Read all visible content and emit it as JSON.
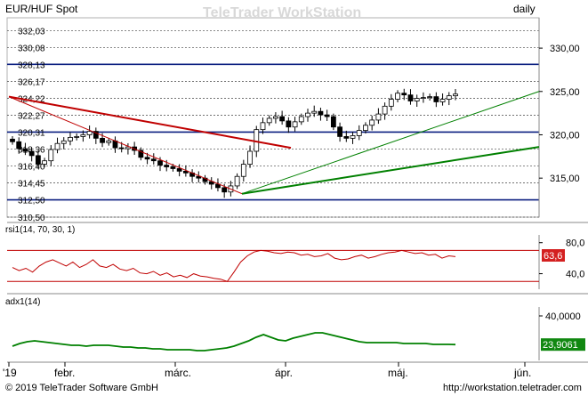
{
  "header": {
    "symbol": "EUR/HUF Spot",
    "watermark": "TeleTrader WorkStation",
    "interval": "daily"
  },
  "footer": {
    "copyright": "© 2019 TeleTrader Software GmbH",
    "url": "http://workstation.teletrader.com"
  },
  "chart_data": [
    {
      "type": "candlestick",
      "panel": "price",
      "x_labels": [
        "'19",
        "febr.",
        "márc.",
        "ápr.",
        "máj.",
        "jún."
      ],
      "y_ticks": [
        315.0,
        320.0,
        325.0,
        330.0
      ],
      "y_range": [
        310.5,
        333.5
      ],
      "fib_levels": [
        332.03,
        330.08,
        328.13,
        326.17,
        324.22,
        322.27,
        320.31,
        318.36,
        316.4,
        314.45,
        312.5,
        310.5
      ],
      "fib_labels": [
        "332,03",
        "330,08",
        "328,13",
        "326,17",
        "324,22",
        "322,27",
        "320,31",
        "318,36",
        "316,40",
        "314,45",
        "312,50",
        "310,50"
      ],
      "grid": "horizontal",
      "closes": [
        319.2,
        318.4,
        318.1,
        317.6,
        316.6,
        317.0,
        318.3,
        319.0,
        319.3,
        319.7,
        319.8,
        320.0,
        320.4,
        319.6,
        319.1,
        319.3,
        318.5,
        318.4,
        318.6,
        318.2,
        317.4,
        317.2,
        317.0,
        316.5,
        316.3,
        316.1,
        315.8,
        315.6,
        315.2,
        315.0,
        314.6,
        314.3,
        313.9,
        313.4,
        314.1,
        315.2,
        316.6,
        318.1,
        320.6,
        321.4,
        321.9,
        322.1,
        321.6,
        320.9,
        321.5,
        322.1,
        322.5,
        322.7,
        322.3,
        322.1,
        320.9,
        319.8,
        319.6,
        319.9,
        320.5,
        321.1,
        321.7,
        322.4,
        323.3,
        324.1,
        324.8,
        324.6,
        323.9,
        324.2,
        324.3,
        324.4,
        323.8,
        324.1,
        324.5,
        324.7
      ],
      "trendlines": [
        {
          "color": "#c00000",
          "from": [
            "'19",
            324.4
          ],
          "to": [
            "márc.",
            318.5
          ]
        },
        {
          "color": "#c00000",
          "from": [
            "'19",
            324.4
          ],
          "to": [
            "ápr.",
            313.2
          ]
        },
        {
          "color": "#008000",
          "from": [
            "ápr.",
            313.2
          ],
          "to": [
            "jún.",
            318.6
          ]
        },
        {
          "color": "#008000",
          "from": [
            "ápr.",
            313.2
          ],
          "to": [
            "jún.",
            325.0
          ]
        }
      ]
    },
    {
      "type": "line",
      "panel": "rsi",
      "title": "rsi1(14, 70, 30, 1)",
      "y_ticks": [
        40.0,
        80.0
      ],
      "y_tick_labels": [
        "40,0",
        "80,0"
      ],
      "y_range": [
        20,
        90
      ],
      "levels": [
        70,
        30
      ],
      "last_value": 63.6,
      "last_value_label": "63,6",
      "series_color": "#c00000",
      "values": [
        48,
        44,
        47,
        42,
        50,
        55,
        58,
        54,
        50,
        55,
        48,
        52,
        58,
        50,
        48,
        52,
        46,
        44,
        47,
        41,
        40,
        43,
        38,
        41,
        36,
        38,
        35,
        40,
        37,
        36,
        34,
        33,
        30,
        42,
        55,
        63,
        68,
        70,
        69,
        67,
        66,
        68,
        67,
        64,
        65,
        62,
        63,
        66,
        60,
        58,
        59,
        62,
        64,
        60,
        62,
        65,
        67,
        68,
        70,
        68,
        66,
        67,
        64,
        65,
        60,
        63,
        62
      ]
    },
    {
      "type": "line",
      "panel": "adx",
      "title": "adx1(14)",
      "y_ticks": [
        40.0
      ],
      "y_tick_labels": [
        "40,0000"
      ],
      "y_range": [
        15,
        45
      ],
      "last_value": 23.9061,
      "last_value_label": "23,9061",
      "series_color": "#008000",
      "values": [
        23,
        24.5,
        25.5,
        26,
        25.5,
        25,
        24.5,
        24,
        23.5,
        23.5,
        23,
        23.5,
        23.5,
        23.5,
        23,
        22.5,
        22.5,
        22,
        22,
        21.5,
        21.5,
        21,
        21,
        21,
        21,
        20.5,
        20.5,
        21,
        21.5,
        22,
        23,
        24.5,
        26,
        28,
        29.5,
        28,
        26.5,
        26,
        27.5,
        28.5,
        29.5,
        30.5,
        30.5,
        29.5,
        28.5,
        27.5,
        26.5,
        25.5,
        25,
        25,
        25,
        25,
        25,
        24.5,
        24.5,
        24.5,
        24.5,
        24,
        24,
        24,
        23.9061
      ]
    }
  ],
  "colors": {
    "candle_up": "#ffffff",
    "candle_down": "#000000",
    "watermark": "#d8d8d8",
    "rsi_badge": "#d42020",
    "adx_badge": "#118811",
    "blue_level": "#0b1f80"
  }
}
